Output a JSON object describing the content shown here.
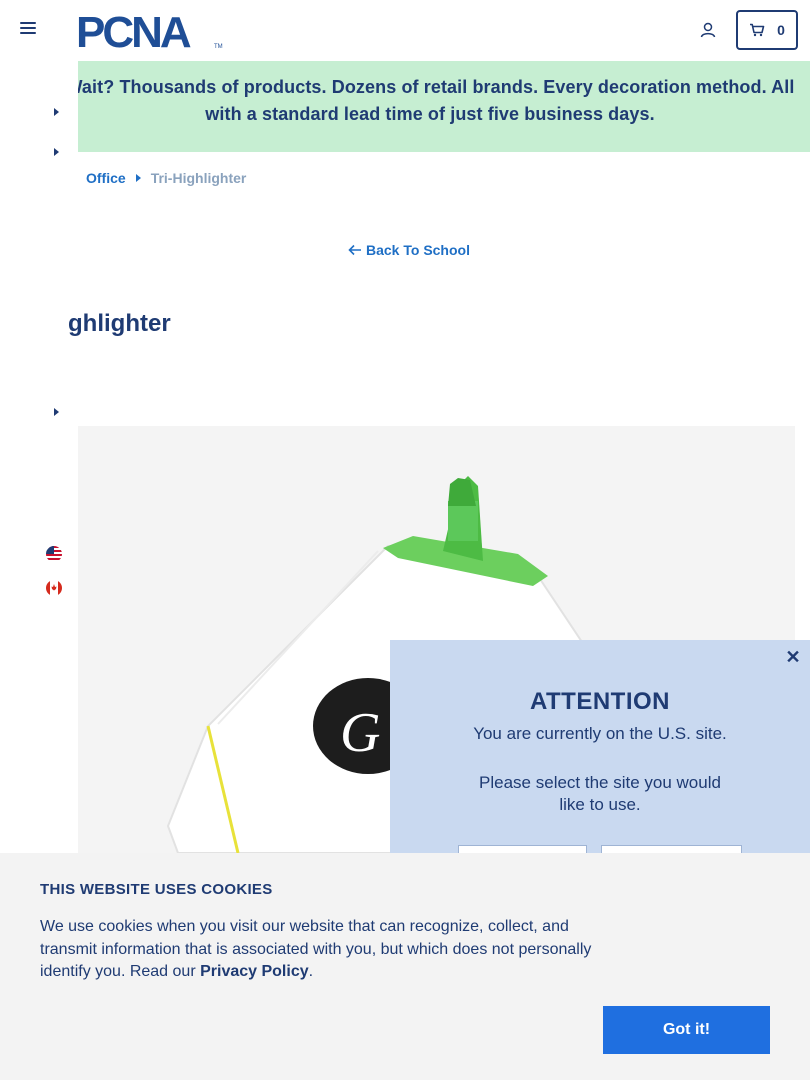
{
  "header": {
    "logo_text": "PCNA",
    "logo_tm": "TM",
    "cart_count": "0"
  },
  "banner": {
    "text": "Wait? Thousands of products. Dozens of retail brands. Every decoration method. All with a standard lead time of just five business days."
  },
  "breadcrumb": {
    "items": [
      {
        "label": "Office"
      },
      {
        "label": "Tri-Highlighter"
      }
    ]
  },
  "back_link": {
    "label": "Back To School"
  },
  "product": {
    "title_visible": "ghlighter"
  },
  "modal": {
    "title": "ATTENTION",
    "line1": "You are currently on the U.S. site.",
    "line2": "Please select the site you would like to use.",
    "close": "✕"
  },
  "cookie": {
    "title": "THIS WEBSITE USES COOKIES",
    "text": "We use cookies when you visit our website that can recognize, collect, and transmit information that is associated with you, but which does not personally identify you. Read our ",
    "link": "Privacy Policy",
    "after": ".",
    "button": "Got it!"
  },
  "colors": {
    "brand_navy": "#1f3b73",
    "link_blue": "#1f6fc5",
    "banner_green": "#c6eed2",
    "modal_blue": "#c9d9f0",
    "button_blue": "#1f6fe0",
    "highlighter_green": "#5cc85a"
  },
  "icons": {
    "menu": "hamburger-icon",
    "account": "user-icon",
    "cart": "cart-icon",
    "back": "arrow-left-icon",
    "close": "close-icon",
    "flag_us": "us-flag-icon",
    "flag_ca": "canada-flag-icon"
  }
}
